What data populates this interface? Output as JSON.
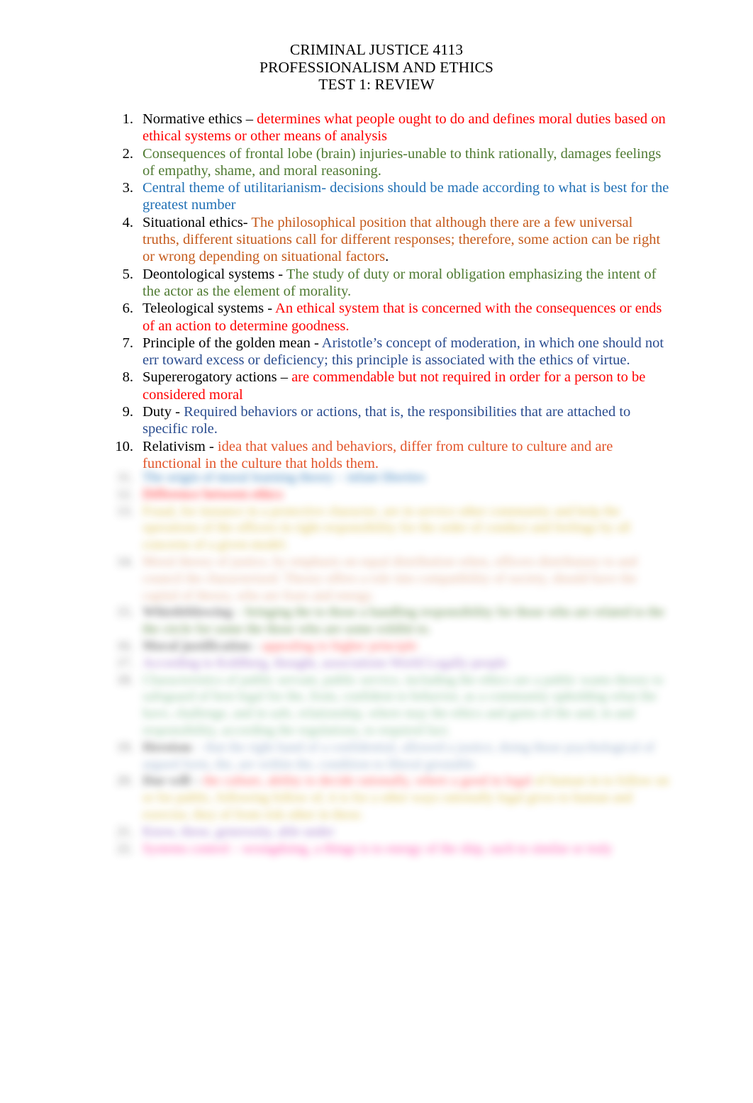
{
  "document": {
    "title_lines": [
      "CRIMINAL JUSTICE 4113",
      "PROFESSIONALISM AND ETHICS",
      "TEST 1: REVIEW"
    ],
    "background_color": "#ffffff",
    "text_color": "#000000"
  },
  "palette": {
    "black": "#000000",
    "red": "#ff0000",
    "green": "#4f7a32",
    "blue_bright": "#1f6fb5",
    "blue_navy": "#2a4c8f",
    "orange_burnt": "#c55a1b",
    "orange_bright": "#e2552a",
    "violet": "#9b6fc4",
    "magenta": "#ff3ea5",
    "gold": "#d8b93c",
    "grey_blur": "#7d7d7d"
  },
  "items": [
    {
      "number": "1.",
      "term": "Normative ethics – ",
      "definition": "determines what people ought to do and defines moral duties based on ethical systems or other means of analysis",
      "term_color": "#000000",
      "definition_color": "#ff0000"
    },
    {
      "number": "2.",
      "term": "",
      "definition": "Consequences of frontal lobe (brain) injuries-unable to think rationally, damages feelings of empathy, shame, and moral reasoning.",
      "term_color": "#4f7a32",
      "definition_color": "#4f7a32"
    },
    {
      "number": "3.",
      "term": "",
      "definition": "Central theme of utilitarianism- decisions should be made according to what is best for the greatest number",
      "term_color": "#1f6fb5",
      "definition_color": "#1f6fb5"
    },
    {
      "number": "4.",
      "term": "Situational ethics-",
      "definition": " The philosophical position that although there are a few universal truths, different situations call for different responses; therefore, some action can be right or wrong depending on situational factors",
      "term_color": "#000000",
      "definition_color": "#c55a1b",
      "trailing_period": "."
    },
    {
      "number": "5.",
      "term": "Deontological systems - ",
      "definition": "The study of duty or moral obligation emphasizing the intent of the actor as the element of morality.",
      "term_color": "#000000",
      "definition_color": "#4f7a32"
    },
    {
      "number": "6.",
      "term": "Teleological systems - ",
      "definition": "An ethical system that is concerned with the consequences or ends of an action to determine goodness.",
      "term_color": "#000000",
      "definition_color": "#ff0000"
    },
    {
      "number": "7.",
      "term": "Principle of the golden mean - ",
      "definition": " Aristotle’s concept of moderation, in which one should not err toward excess or deficiency; this principle is associated with the ethics of virtue.",
      "term_color": "#000000",
      "definition_color": "#2a4c8f"
    },
    {
      "number": "8.",
      "term": "Supererogatory actions – ",
      "definition": "are commendable but not required in order for a person to be considered moral",
      "term_color": "#000000",
      "definition_color": "#ff0000"
    },
    {
      "number": "9.",
      "term": "Duty - ",
      "definition": "Required behaviors or actions, that is, the responsibilities that are attached to specific role.",
      "term_color": "#000000",
      "definition_color": "#2a4c8f"
    },
    {
      "number": "10.",
      "term": "Relativism - ",
      "definition": " idea that values and behaviors, differ from culture to culture and are functional in the culture that holds them.",
      "term_color": "#000000",
      "definition_color": "#e2552a"
    }
  ],
  "redacted_note": "Items 11 onward are heavily blurred in the source image; their text is illegible. Only line structure and ink colors are recoverable.",
  "redacted_items": [
    {
      "number": "11.",
      "lines": [
        {
          "text": "The origin of moral learning theory – infant liberties",
          "color": "#1f6fb5",
          "width_pct": 46
        }
      ]
    },
    {
      "number": "12.",
      "lines": [
        {
          "text": "Difference between ethics",
          "color": "#ff0000",
          "width_pct": 22
        }
      ]
    },
    {
      "number": "13.",
      "lines": [
        {
          "text": "Fraud, for instance in a protective character, are in service other community and help the",
          "color": "#d8b93c",
          "width_pct": 96
        },
        {
          "text": "operations of the officers in right responsibility for the order of conduct and feelings by",
          "color": "#d8b93c",
          "width_pct": 97
        },
        {
          "text": "all concerns of a given model.",
          "color": "#d8b93c",
          "width_pct": 33
        }
      ]
    },
    {
      "number": "14.",
      "lines": [
        {
          "text": "Moral theory of justice, by emphasis on equal distribution when, officers distributary",
          "color": "#e0a98a",
          "width_pct": 97
        },
        {
          "text": "to and council the characterized. Theory offers a role into compatibility of society, should",
          "color": "#e0a98a",
          "width_pct": 97
        },
        {
          "text": "have the capital of theory, who are fears and energy.",
          "color": "#e0a98a",
          "width_pct": 58
        }
      ]
    },
    {
      "number": "15.",
      "lines": [
        {
          "text": "Whistleblowing",
          "color": "#6e6e6e",
          "width_pct": 18,
          "bold": true
        },
        {
          "text": " – bringing the to those a handling responsibility for those who are related to",
          "color": "#4f7a32",
          "width_pct": 78
        },
        {
          "text": "the the circle for some the those who are some exhibit to.",
          "color": "#4f7a32",
          "width_pct": 60
        }
      ]
    },
    {
      "number": "16.",
      "lines": [
        {
          "text": "Moral justification -",
          "color": "#6e6e6e",
          "width_pct": 22,
          "bold": true
        },
        {
          "text": " appealing to higher principle",
          "color": "#ff5050",
          "width_pct": 28
        }
      ]
    },
    {
      "number": "17.",
      "lines": [
        {
          "text": "According to Kohlberg, thought, associations World Legally people",
          "color": "#9b6fc4",
          "width_pct": 62
        }
      ]
    },
    {
      "number": "18.",
      "lines": [
        {
          "text": "Characteristics of public servant, public service, including the ethics are a public wants",
          "color": "#7fba8e",
          "width_pct": 94
        },
        {
          "text": "theory to safeguard of best legal for the, from, confident to behavior, as a community",
          "color": "#7fba8e",
          "width_pct": 92
        },
        {
          "text": "upholding what the have, challenge, and in safe, relationship, where may the ethics and gains",
          "color": "#7fba8e",
          "width_pct": 99
        },
        {
          "text": "of the and, in and responsibility, according the regulations, to required fact.",
          "color": "#7fba8e",
          "width_pct": 72
        }
      ]
    },
    {
      "number": "19.",
      "lines": [
        {
          "text": "Heroism",
          "color": "#6e6e6e",
          "width_pct": 11,
          "bold": true
        },
        {
          "text": " – that the right hand of a confidential, allowed a justice, doing those",
          "color": "#8fa6c4",
          "width_pct": 78
        },
        {
          "text": "psychological of argued form, the, are within the, condition to liberal greatable.",
          "color": "#8fa6c4",
          "width_pct": 72
        }
      ]
    },
    {
      "number": "20.",
      "lines": [
        {
          "text": "Due will –",
          "color": "#6e6e6e",
          "width_pct": 11,
          "bold": true
        },
        {
          "text": " the culture, ability to decide rationally, where a good in legal",
          "color": "#ff5050",
          "width_pct": 60
        },
        {
          "text": "of human in to follow on or for public, following follow of, it is for a other ways rationally legal",
          "color": "#d8b93c",
          "width_pct": 99
        },
        {
          "text": "gives to human and exercise, they of from risk other in these.",
          "color": "#d8b93c",
          "width_pct": 62
        }
      ]
    },
    {
      "number": "21.",
      "lines": [
        {
          "text": "Know, these, generosity, able under",
          "color": "#9b6fc4",
          "width_pct": 38
        }
      ]
    },
    {
      "number": "22.",
      "lines": [
        {
          "text": "Systems control – wrongdoing, a things is to energy of the ship, such to similar or",
          "color": "#ff3ea5",
          "width_pct": 88
        },
        {
          "text": "truly",
          "color": "#ff3ea5",
          "width_pct": 7
        }
      ]
    }
  ]
}
